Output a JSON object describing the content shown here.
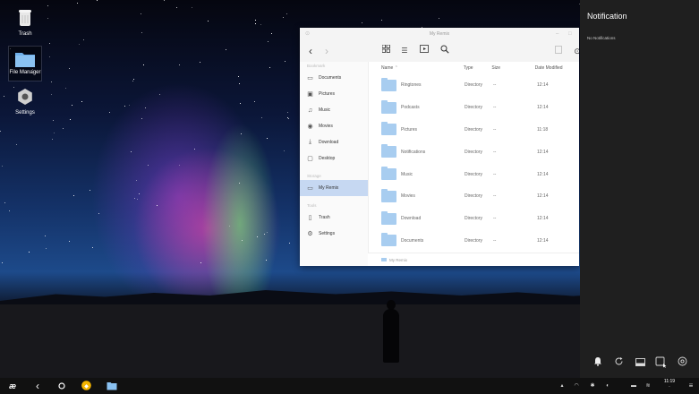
{
  "desktop": {
    "icons": [
      {
        "label": "Trash",
        "icon": "trash-icon"
      },
      {
        "label": "File Manager",
        "icon": "folder-icon"
      },
      {
        "label": "Settings",
        "icon": "gear-icon"
      }
    ]
  },
  "file_manager": {
    "title": "My Remix",
    "sidebar": {
      "bookmark_header": "Bookmark",
      "bookmarks": [
        {
          "label": "Documents",
          "icon": "document-icon"
        },
        {
          "label": "Pictures",
          "icon": "picture-icon"
        },
        {
          "label": "Music",
          "icon": "music-icon"
        },
        {
          "label": "Movies",
          "icon": "movie-icon"
        },
        {
          "label": "Download",
          "icon": "download-icon"
        },
        {
          "label": "Desktop",
          "icon": "desktop-icon"
        }
      ],
      "storage_header": "Storage",
      "storage": [
        {
          "label": "My Remix",
          "icon": "computer-icon"
        }
      ],
      "tools_header": "Tools",
      "tools": [
        {
          "label": "Trash",
          "icon": "trash-icon"
        },
        {
          "label": "Settings",
          "icon": "gear-icon"
        }
      ]
    },
    "columns": {
      "name": "Name",
      "type": "Type",
      "size": "Size",
      "date": "Date Modified"
    },
    "files": [
      {
        "name": "Ringtones",
        "type": "Directory",
        "size": "--",
        "date": "12:14"
      },
      {
        "name": "Podcasts",
        "type": "Directory",
        "size": "--",
        "date": "12:14"
      },
      {
        "name": "Pictures",
        "type": "Directory",
        "size": "--",
        "date": "11:18"
      },
      {
        "name": "Notifications",
        "type": "Directory",
        "size": "--",
        "date": "12:14"
      },
      {
        "name": "Music",
        "type": "Directory",
        "size": "--",
        "date": "12:14"
      },
      {
        "name": "Movies",
        "type": "Directory",
        "size": "--",
        "date": "12:14"
      },
      {
        "name": "Download",
        "type": "Directory",
        "size": "--",
        "date": "12:14"
      },
      {
        "name": "Documents",
        "type": "Directory",
        "size": "--",
        "date": "12:14"
      }
    ],
    "status_path": "My Remix"
  },
  "notification": {
    "title": "Notification",
    "empty_text": "No Notifications"
  },
  "taskbar": {
    "clock_time": "11:19",
    "clock_sub": "·"
  },
  "colors": {
    "folder": "#a8cdf0",
    "selected_sidebar": "#c6d8f2",
    "panel_bg": "#1f1f1f",
    "taskbar_bg": "#111111"
  }
}
